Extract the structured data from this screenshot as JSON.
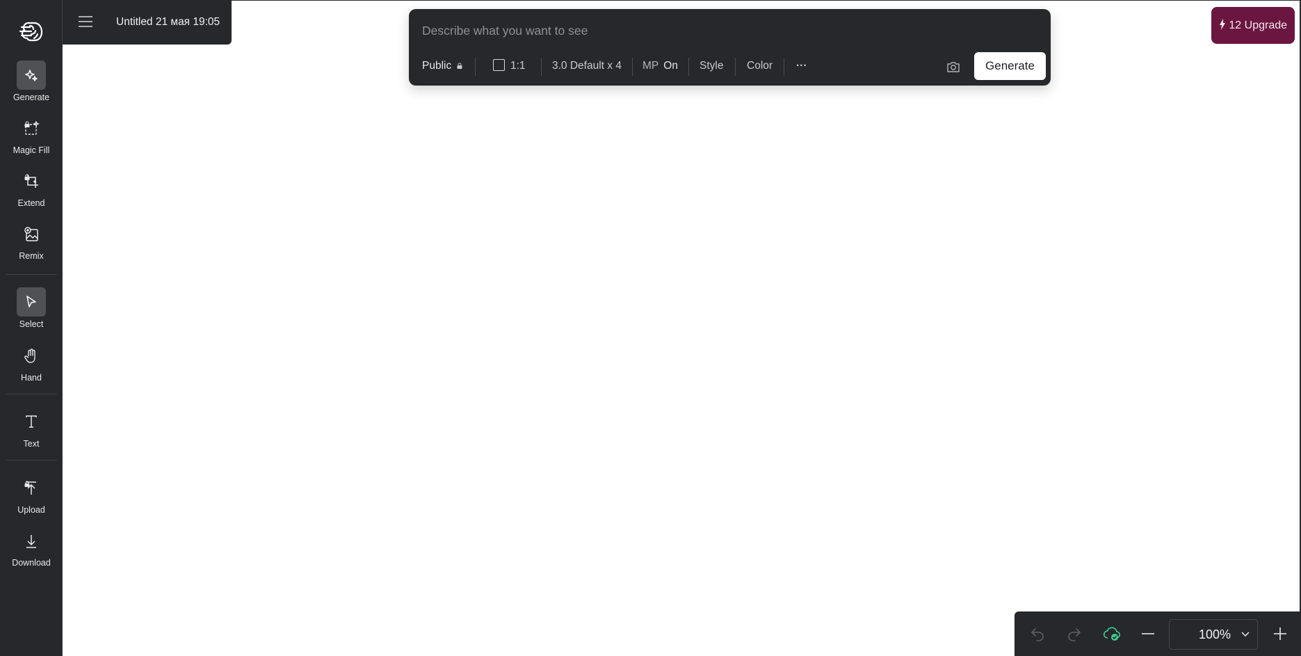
{
  "document": {
    "title": "Untitled 21 мая 19:05"
  },
  "sidebar": {
    "tools": [
      {
        "label": "Generate",
        "icon": "sparkle-icon",
        "active": true
      },
      {
        "label": "Magic Fill",
        "icon": "magic-fill-icon",
        "locked": true
      },
      {
        "label": "Extend",
        "icon": "crop-extend-icon",
        "locked": true
      },
      {
        "label": "Remix",
        "icon": "image-add-icon"
      },
      {
        "label": "Select",
        "icon": "cursor-icon",
        "active": true
      },
      {
        "label": "Hand",
        "icon": "hand-icon"
      },
      {
        "label": "Text",
        "icon": "text-icon"
      },
      {
        "label": "Upload",
        "icon": "upload-icon",
        "locked": true
      },
      {
        "label": "Download",
        "icon": "download-icon"
      }
    ]
  },
  "prompt": {
    "placeholder": "Describe what you want to see",
    "options": {
      "visibility": "Public",
      "aspect_ratio": "1:1",
      "model": "3.0 Default x 4",
      "mp_label": "MP",
      "mp_value": "On",
      "style": "Style",
      "color": "Color",
      "more": "···"
    },
    "generate_label": "Generate"
  },
  "upgrade": {
    "credits": "12",
    "label": "Upgrade"
  },
  "bottom_bar": {
    "zoom": "100%"
  },
  "colors": {
    "panel": "#27282b",
    "upgrade_bg": "#6b1640",
    "cloud_ok": "#3fcf8e"
  }
}
